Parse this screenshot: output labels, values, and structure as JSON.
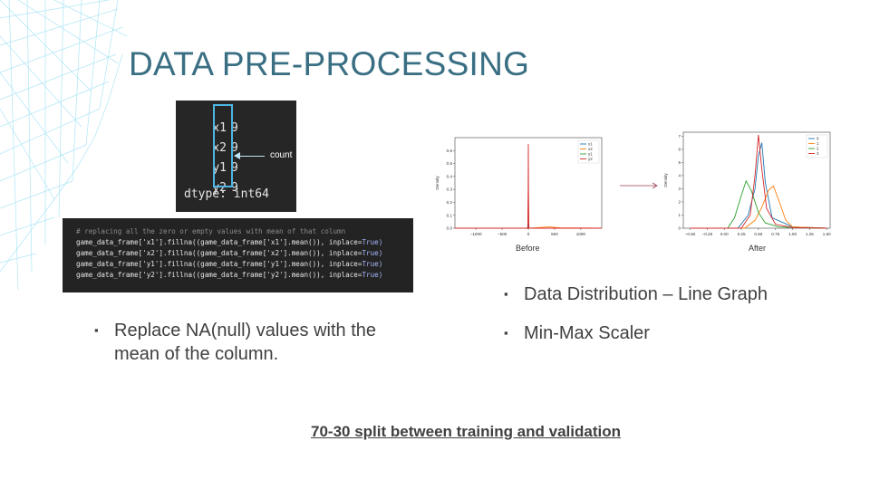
{
  "slide": {
    "title": "DATA PRE-PROCESSING",
    "footer": "70-30 split between training and validation"
  },
  "terminal_counts": {
    "rows": [
      {
        "name": "x1",
        "value": "9"
      },
      {
        "name": "x2",
        "value": "9"
      },
      {
        "name": "y1",
        "value": "9"
      },
      {
        "name": "y2",
        "value": "9"
      }
    ],
    "dtype_line": "dtype: int64",
    "annotation": "count",
    "highlight_color": "#4fb6e3"
  },
  "code_block": {
    "comment": "# replacing all the zero or empty values with mean of that column",
    "lines": [
      {
        "code": "game_data_frame['x1'].fillna((game_data_frame['x1'].mean()), inplace=",
        "kw": "True)"
      },
      {
        "code": "game_data_frame['x2'].fillna((game_data_frame['x2'].mean()), inplace=",
        "kw": "True)"
      },
      {
        "code": "game_data_frame['y1'].fillna((game_data_frame['y1'].mean()), inplace=",
        "kw": "True)"
      },
      {
        "code": "game_data_frame['y2'].fillna((game_data_frame['y2'].mean()), inplace=",
        "kw": "True)"
      }
    ]
  },
  "bullets_left": [
    {
      "line1": "Replace NA(null) values with the",
      "line2": "mean of the column."
    }
  ],
  "bullets_right": [
    {
      "text": "Data Distribution – Line Graph"
    },
    {
      "text": "Min-Max Scaler"
    }
  ],
  "colors": {
    "title": "#3a6f83",
    "blue": "#1f77b4",
    "orange": "#ff7f0e",
    "green": "#2ca02c",
    "red": "#d62728"
  },
  "chart_data": [
    {
      "type": "line",
      "caption": "Before",
      "ylabel": "Density",
      "xlim": [
        -1400,
        1400
      ],
      "ylim": [
        0,
        0.7
      ],
      "xticks": [
        -1000,
        -500,
        0,
        500,
        1000
      ],
      "xtick_labels": [
        "−1000",
        "−500",
        "0",
        "500",
        "1000"
      ],
      "yticks": [
        0.0,
        0.1,
        0.2,
        0.3,
        0.4,
        0.5,
        0.6
      ],
      "ytick_labels": [
        "0.0",
        "0.1",
        "0.2",
        "0.3",
        "0.4",
        "0.5",
        "0.6"
      ],
      "legend_loc": "top-right",
      "series": [
        {
          "name": "x1",
          "color": "#1f77b4",
          "x": [
            -1400,
            -20,
            -5,
            0,
            5,
            20,
            1400
          ],
          "y": [
            0,
            0,
            0.02,
            0.04,
            0.02,
            0,
            0
          ]
        },
        {
          "name": "x2",
          "color": "#ff7f0e",
          "x": [
            -1400,
            -30,
            0,
            30,
            200,
            400,
            600,
            1400
          ],
          "y": [
            0,
            0,
            0.01,
            0,
            0.005,
            0.01,
            0.003,
            0
          ]
        },
        {
          "name": "y1",
          "color": "#2ca02c",
          "x": [
            -1400,
            -15,
            0,
            15,
            1400
          ],
          "y": [
            0,
            0,
            0.01,
            0,
            0
          ]
        },
        {
          "name": "y2",
          "color": "#d62728",
          "x": [
            -1400,
            -10,
            -3,
            0,
            3,
            10,
            1400
          ],
          "y": [
            0,
            0,
            0.3,
            0.65,
            0.3,
            0,
            0
          ]
        }
      ]
    },
    {
      "type": "line",
      "caption": "After",
      "ylabel": "Density",
      "xlim": [
        -0.6,
        1.55
      ],
      "ylim": [
        0,
        7.3
      ],
      "xticks": [
        -0.5,
        -0.25,
        0.0,
        0.25,
        0.5,
        0.75,
        1.0,
        1.25,
        1.5
      ],
      "xtick_labels": [
        "−0.50",
        "−0.25",
        "0.00",
        "0.25",
        "0.50",
        "0.75",
        "1.00",
        "1.25",
        "1.50"
      ],
      "yticks": [
        0,
        1,
        2,
        3,
        4,
        5,
        6,
        7
      ],
      "ytick_labels": [
        "0",
        "1",
        "2",
        "3",
        "4",
        "5",
        "6",
        "7"
      ],
      "legend_loc": "top-right",
      "series": [
        {
          "name": "0",
          "color": "#1f77b4",
          "x": [
            -0.5,
            0.2,
            0.35,
            0.45,
            0.5,
            0.55,
            0.6,
            0.7,
            1.0,
            1.5
          ],
          "y": [
            0,
            0,
            1.0,
            3.0,
            5.5,
            6.5,
            3.5,
            0.8,
            0.1,
            0
          ]
        },
        {
          "name": "1",
          "color": "#ff7f0e",
          "x": [
            -0.5,
            0.3,
            0.45,
            0.55,
            0.65,
            0.72,
            0.8,
            0.9,
            1.0,
            1.5
          ],
          "y": [
            0,
            0,
            0.6,
            1.6,
            2.9,
            3.2,
            2.1,
            0.6,
            0.1,
            0
          ]
        },
        {
          "name": "2",
          "color": "#2ca02c",
          "x": [
            -0.5,
            0.05,
            0.15,
            0.25,
            0.32,
            0.4,
            0.5,
            0.6,
            0.8,
            1.0,
            1.5
          ],
          "y": [
            0,
            0,
            0.8,
            2.5,
            3.6,
            2.8,
            1.2,
            0.4,
            0.1,
            0.05,
            0
          ]
        },
        {
          "name": "3",
          "color": "#d62728",
          "x": [
            -0.5,
            0.25,
            0.38,
            0.45,
            0.5,
            0.55,
            0.62,
            0.75,
            1.0,
            1.5
          ],
          "y": [
            0,
            0,
            1.0,
            4.0,
            7.1,
            4.5,
            1.5,
            0.3,
            0.05,
            0
          ]
        }
      ]
    }
  ]
}
